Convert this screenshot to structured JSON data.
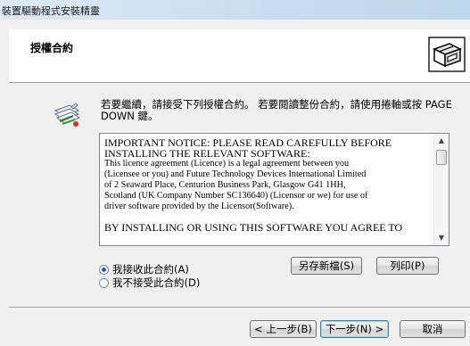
{
  "window": {
    "title": "裝置驅動程式安裝精靈"
  },
  "header": {
    "title": "授權合約",
    "icon": "installer-box-icon"
  },
  "instruction": "若要繼續，請接受下列授權合約。 若要閱讀整份合約，請使用捲軸或按 PAGE DOWN 鍵。",
  "license": {
    "heading_1": "IMPORTANT NOTICE: PLEASE READ CAREFULLY BEFORE",
    "heading_2": "INSTALLING THE RELEVANT SOFTWARE:",
    "body_1": "This licence agreement (Licence) is a legal agreement between you",
    "body_2": "(Licensee or you) and Future Technology Devices International Limited",
    "body_3": "of 2 Seaward Place, Centurion Business Park, Glasgow G41 1HH,",
    "body_4": "Scotland (UK Company Number SC136640) (Licensor or we) for use of",
    "body_5": "driver software provided by the Licensor(Software).",
    "tail": "BY INSTALLING OR USING THIS SOFTWARE YOU AGREE TO"
  },
  "options": {
    "accept": "我接收此合約(A)",
    "decline": "我不接受此合約(D)",
    "selected": "accept"
  },
  "buttons": {
    "save_as": "另存新檔(S)",
    "print": "列印(P)",
    "back": "< 上一步(B)",
    "next": "下一步(N) >",
    "cancel": "取消"
  },
  "colors": {
    "radio_selected": "#1e63b9",
    "default_button_border": "#3c7fb1"
  }
}
